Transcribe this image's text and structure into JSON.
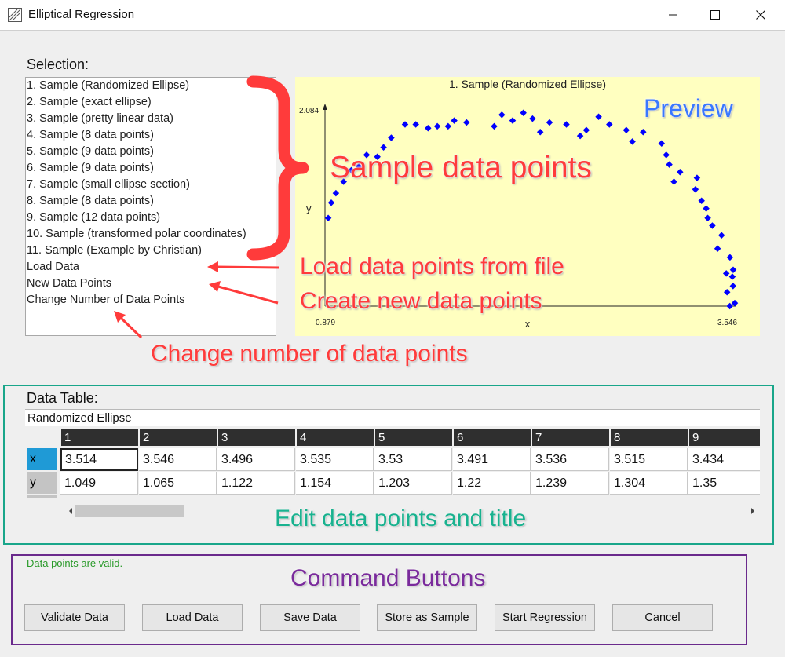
{
  "window": {
    "title": "Elliptical Regression"
  },
  "selection": {
    "label": "Selection:",
    "items": [
      "1. Sample (Randomized Ellipse)",
      "2. Sample (exact ellipse)",
      "3. Sample (pretty linear data)",
      "4. Sample (8 data points)",
      "5. Sample (9 data points)",
      "6. Sample (9 data points)",
      "7. Sample (small ellipse section)",
      "8. Sample (8 data points)",
      "9. Sample (12 data points)",
      "10. Sample (transformed polar coordinates)",
      "11. Sample (Example by Christian)",
      "Load Data",
      "New Data Points",
      "Change Number of Data Points"
    ]
  },
  "preview": {
    "background": "#ffffc0",
    "point_color": "#0000ff"
  },
  "chart_data": {
    "type": "scatter",
    "title": "1. Sample (Randomized Ellipse)",
    "xlabel": "x",
    "ylabel": "y",
    "x_min_label": "0.879",
    "x_max_label": "3.546",
    "y_max_label": "2.084",
    "xlim": [
      0.879,
      3.546
    ],
    "ylim": [
      1.049,
      2.084
    ],
    "points": [
      [
        3.514,
        1.049
      ],
      [
        3.546,
        1.065
      ],
      [
        3.496,
        1.122
      ],
      [
        3.535,
        1.154
      ],
      [
        3.53,
        1.203
      ],
      [
        3.491,
        1.22
      ],
      [
        3.536,
        1.239
      ],
      [
        3.515,
        1.304
      ],
      [
        3.434,
        1.35
      ],
      [
        3.46,
        1.42
      ],
      [
        3.4,
        1.47
      ],
      [
        3.37,
        1.51
      ],
      [
        3.36,
        1.56
      ],
      [
        3.33,
        1.6
      ],
      [
        3.29,
        1.66
      ],
      [
        3.3,
        1.72
      ],
      [
        3.15,
        1.7
      ],
      [
        3.19,
        1.75
      ],
      [
        3.12,
        1.79
      ],
      [
        3.1,
        1.84
      ],
      [
        3.07,
        1.9
      ],
      [
        2.95,
        1.96
      ],
      [
        2.88,
        1.91
      ],
      [
        2.84,
        1.97
      ],
      [
        2.73,
        2.0
      ],
      [
        2.66,
        2.04
      ],
      [
        2.58,
        1.97
      ],
      [
        2.54,
        1.94
      ],
      [
        2.45,
        2.0
      ],
      [
        2.34,
        2.01
      ],
      [
        2.28,
        1.96
      ],
      [
        2.23,
        2.03
      ],
      [
        2.17,
        2.06
      ],
      [
        2.1,
        2.02
      ],
      [
        2.03,
        2.05
      ],
      [
        1.98,
        1.99
      ],
      [
        1.8,
        2.01
      ],
      [
        1.72,
        2.02
      ],
      [
        1.68,
        1.99
      ],
      [
        1.61,
        1.99
      ],
      [
        1.55,
        1.98
      ],
      [
        1.47,
        2.0
      ],
      [
        1.4,
        2.0
      ],
      [
        1.31,
        1.93
      ],
      [
        1.26,
        1.88
      ],
      [
        1.22,
        1.83
      ],
      [
        1.15,
        1.84
      ],
      [
        1.1,
        1.78
      ],
      [
        1.05,
        1.76
      ],
      [
        1.0,
        1.7
      ],
      [
        0.95,
        1.64
      ],
      [
        0.92,
        1.59
      ],
      [
        0.9,
        1.51
      ]
    ]
  },
  "data_table": {
    "label": "Data Table:",
    "title_value": "Randomized Ellipse",
    "columns": [
      "1",
      "2",
      "3",
      "4",
      "5",
      "6",
      "7",
      "8",
      "9"
    ],
    "rows": [
      {
        "name": "x",
        "values": [
          "3.514",
          "3.546",
          "3.496",
          "3.535",
          "3.53",
          "3.491",
          "3.536",
          "3.515",
          "3.434"
        ]
      },
      {
        "name": "y",
        "values": [
          "1.049",
          "1.065",
          "1.122",
          "1.154",
          "1.203",
          "1.22",
          "1.239",
          "1.304",
          "1.35"
        ]
      }
    ]
  },
  "status": {
    "text": "Data points are valid."
  },
  "buttons": {
    "validate": "Validate Data",
    "load": "Load Data",
    "save": "Save Data",
    "store": "Store as Sample",
    "start": "Start Regression",
    "cancel": "Cancel"
  },
  "annotations": {
    "preview": "Preview",
    "sample_points": "Sample data points",
    "load_file": "Load data points from file",
    "create_new": "Create new data points",
    "change_number": "Change number of data points",
    "edit": "Edit data points and title",
    "commands": "Command Buttons"
  }
}
